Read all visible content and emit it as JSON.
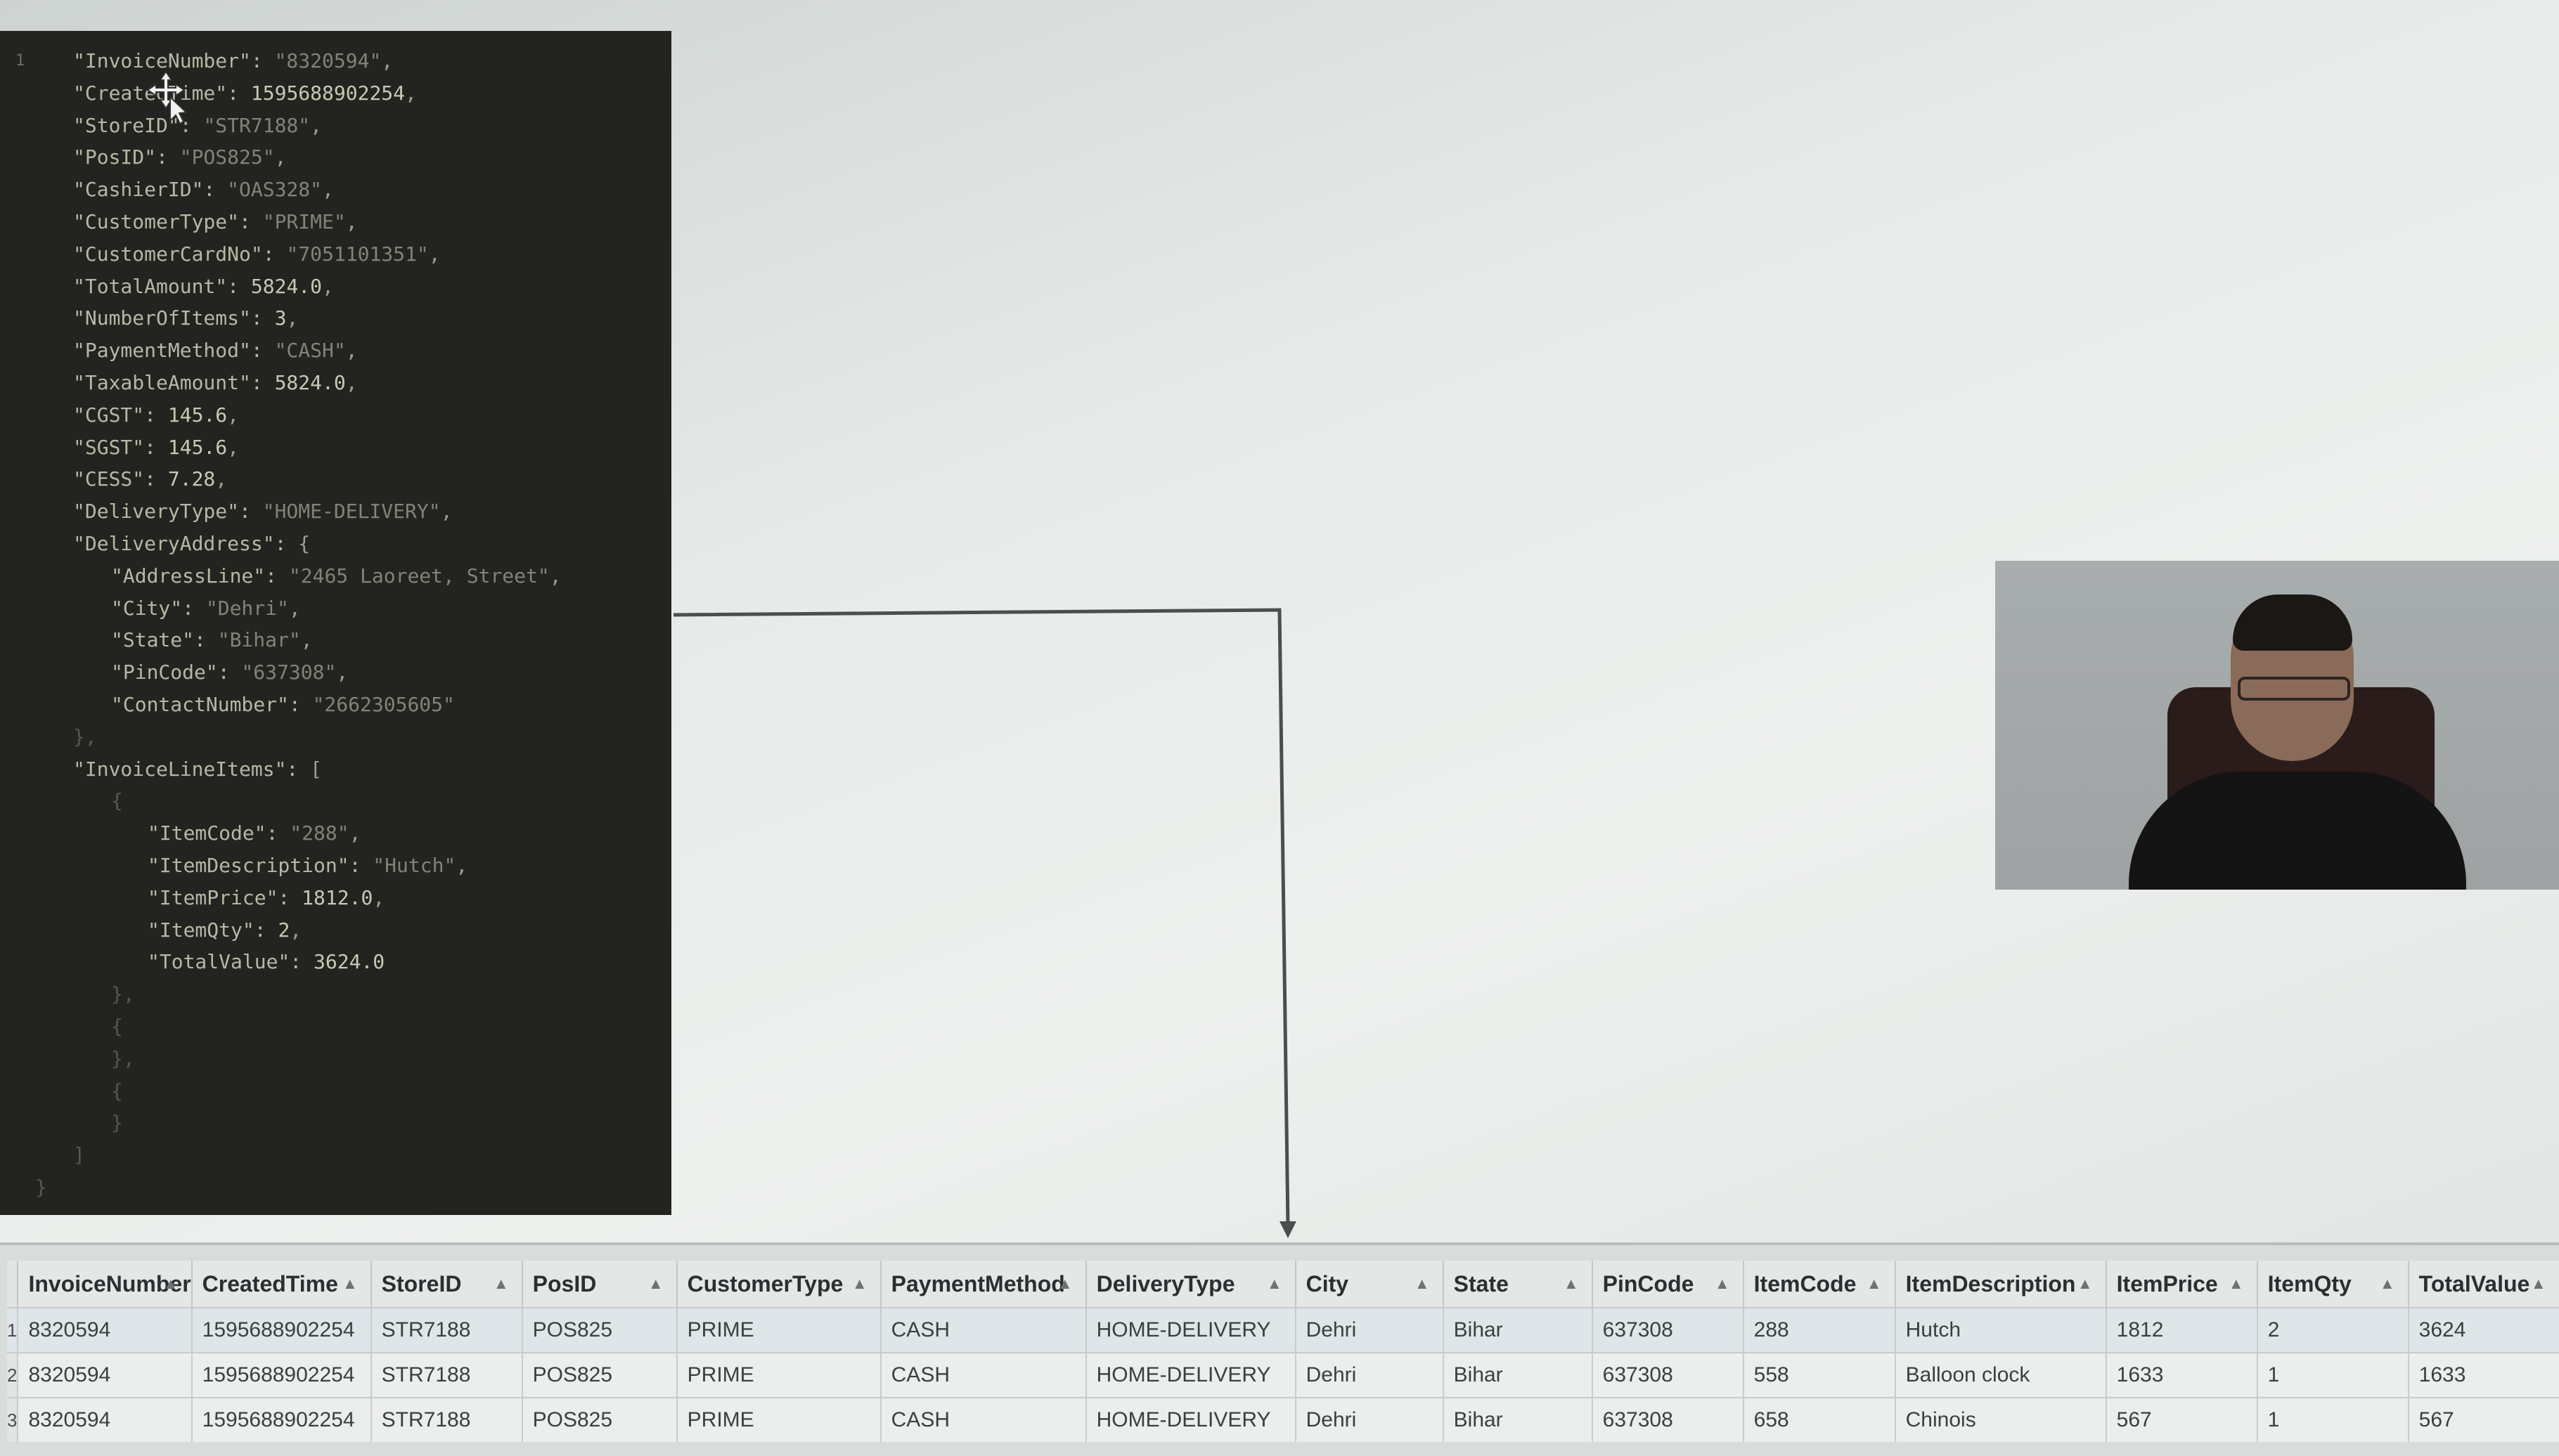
{
  "code_panel": {
    "lines": [
      {
        "gutter": "1",
        "indent": 1,
        "key": "\"InvoiceNumber\": ",
        "value": "\"8320594\"",
        "vtype": "str",
        "tail": ","
      },
      {
        "gutter": "",
        "indent": 1,
        "key": "\"CreatedTime\": ",
        "value": "1595688902254",
        "vtype": "num",
        "tail": ","
      },
      {
        "gutter": "",
        "indent": 1,
        "key": "\"StoreID\": ",
        "value": "\"STR7188\"",
        "vtype": "str",
        "tail": ","
      },
      {
        "gutter": "",
        "indent": 1,
        "key": "\"PosID\": ",
        "value": "\"POS825\"",
        "vtype": "str",
        "tail": ","
      },
      {
        "gutter": "",
        "indent": 1,
        "key": "\"CashierID\": ",
        "value": "\"OAS328\"",
        "vtype": "str",
        "tail": ","
      },
      {
        "gutter": "",
        "indent": 1,
        "key": "\"CustomerType\": ",
        "value": "\"PRIME\"",
        "vtype": "str",
        "tail": ","
      },
      {
        "gutter": "",
        "indent": 1,
        "key": "\"CustomerCardNo\": ",
        "value": "\"7051101351\"",
        "vtype": "str",
        "tail": ","
      },
      {
        "gutter": "",
        "indent": 1,
        "key": "\"TotalAmount\": ",
        "value": "5824.0",
        "vtype": "num",
        "tail": ","
      },
      {
        "gutter": "",
        "indent": 1,
        "key": "\"NumberOfItems\": ",
        "value": "3",
        "vtype": "num",
        "tail": ","
      },
      {
        "gutter": "",
        "indent": 1,
        "key": "\"PaymentMethod\": ",
        "value": "\"CASH\"",
        "vtype": "str",
        "tail": ","
      },
      {
        "gutter": "",
        "indent": 1,
        "key": "\"TaxableAmount\": ",
        "value": "5824.0",
        "vtype": "num",
        "tail": ","
      },
      {
        "gutter": "",
        "indent": 1,
        "key": "\"CGST\": ",
        "value": "145.6",
        "vtype": "num",
        "tail": ","
      },
      {
        "gutter": "",
        "indent": 1,
        "key": "\"SGST\": ",
        "value": "145.6",
        "vtype": "num",
        "tail": ","
      },
      {
        "gutter": "",
        "indent": 1,
        "key": "\"CESS\": ",
        "value": "7.28",
        "vtype": "num",
        "tail": ","
      },
      {
        "gutter": "",
        "indent": 1,
        "key": "\"DeliveryType\": ",
        "value": "\"HOME-DELIVERY\"",
        "vtype": "str",
        "tail": ","
      },
      {
        "gutter": "",
        "indent": 1,
        "key": "\"DeliveryAddress\": ",
        "value": "{",
        "vtype": "punct",
        "tail": ""
      },
      {
        "gutter": "",
        "indent": 2,
        "key": "\"AddressLine\": ",
        "value": "\"2465 Laoreet, Street\"",
        "vtype": "str",
        "tail": ","
      },
      {
        "gutter": "",
        "indent": 2,
        "key": "\"City\": ",
        "value": "\"Dehri\"",
        "vtype": "str",
        "tail": ","
      },
      {
        "gutter": "",
        "indent": 2,
        "key": "\"State\": ",
        "value": "\"Bihar\"",
        "vtype": "str",
        "tail": ","
      },
      {
        "gutter": "",
        "indent": 2,
        "key": "\"PinCode\": ",
        "value": "\"637308\"",
        "vtype": "str",
        "tail": ","
      },
      {
        "gutter": "",
        "indent": 2,
        "key": "\"ContactNumber\": ",
        "value": "\"2662305605\"",
        "vtype": "str",
        "tail": ""
      },
      {
        "gutter": "",
        "indent": 1,
        "key": "",
        "value": "},",
        "vtype": "guide",
        "tail": ""
      },
      {
        "gutter": "",
        "indent": 1,
        "key": "\"InvoiceLineItems\": ",
        "value": "[",
        "vtype": "punct",
        "tail": ""
      },
      {
        "gutter": "",
        "indent": 2,
        "key": "",
        "value": "{",
        "vtype": "guide",
        "tail": ""
      },
      {
        "gutter": "",
        "indent": 3,
        "key": "\"ItemCode\": ",
        "value": "\"288\"",
        "vtype": "str",
        "tail": ","
      },
      {
        "gutter": "",
        "indent": 3,
        "key": "\"ItemDescription\": ",
        "value": "\"Hutch\"",
        "vtype": "str",
        "tail": ","
      },
      {
        "gutter": "",
        "indent": 3,
        "key": "\"ItemPrice\": ",
        "value": "1812.0",
        "vtype": "num",
        "tail": ","
      },
      {
        "gutter": "",
        "indent": 3,
        "key": "\"ItemQty\": ",
        "value": "2",
        "vtype": "num",
        "tail": ","
      },
      {
        "gutter": "",
        "indent": 3,
        "key": "\"TotalValue\": ",
        "value": "3624.0",
        "vtype": "num",
        "tail": ""
      },
      {
        "gutter": "",
        "indent": 2,
        "key": "",
        "value": "},",
        "vtype": "guide",
        "tail": ""
      },
      {
        "gutter": "",
        "indent": 2,
        "key": "",
        "value": "{",
        "vtype": "guide",
        "tail": ""
      },
      {
        "gutter": "",
        "indent": 2,
        "key": "",
        "value": "},",
        "vtype": "guide",
        "tail": ""
      },
      {
        "gutter": "",
        "indent": 2,
        "key": "",
        "value": "{",
        "vtype": "guide",
        "tail": ""
      },
      {
        "gutter": "",
        "indent": 2,
        "key": "",
        "value": "}",
        "vtype": "guide",
        "tail": ""
      },
      {
        "gutter": "",
        "indent": 1,
        "key": "",
        "value": "]",
        "vtype": "guide",
        "tail": ""
      },
      {
        "gutter": "",
        "indent": 0,
        "key": "",
        "value": "}",
        "vtype": "guide",
        "tail": ""
      }
    ]
  },
  "table": {
    "columns": [
      "InvoiceNumber",
      "CreatedTime",
      "StoreID",
      "PosID",
      "CustomerType",
      "PaymentMethod",
      "DeliveryType",
      "City",
      "State",
      "PinCode",
      "ItemCode",
      "ItemDescription",
      "ItemPrice",
      "ItemQty",
      "TotalValue"
    ],
    "sort_icon": "sort-up-triangle",
    "rows": [
      {
        "num": "1",
        "cells": [
          "8320594",
          "1595688902254",
          "STR7188",
          "POS825",
          "PRIME",
          "CASH",
          "HOME-DELIVERY",
          "Dehri",
          "Bihar",
          "637308",
          "288",
          "Hutch",
          "1812",
          "2",
          "3624"
        ]
      },
      {
        "num": "2",
        "cells": [
          "8320594",
          "1595688902254",
          "STR7188",
          "POS825",
          "PRIME",
          "CASH",
          "HOME-DELIVERY",
          "Dehri",
          "Bihar",
          "637308",
          "558",
          "Balloon clock",
          "1633",
          "1",
          "1633"
        ]
      },
      {
        "num": "3",
        "cells": [
          "8320594",
          "1595688902254",
          "STR7188",
          "POS825",
          "PRIME",
          "CASH",
          "HOME-DELIVERY",
          "Dehri",
          "Bihar",
          "637308",
          "658",
          "Chinois",
          "567",
          "1",
          "567"
        ]
      }
    ]
  },
  "colors": {
    "code_bg": "#23241f",
    "arrow": "#4a4e50",
    "table_header_bg": "#e4e7e6"
  }
}
